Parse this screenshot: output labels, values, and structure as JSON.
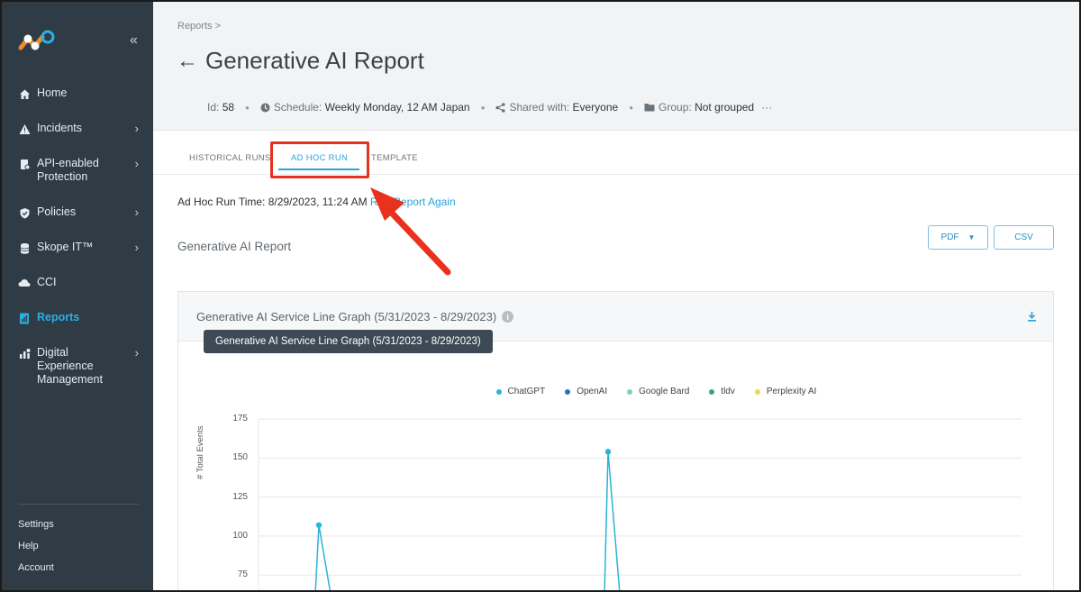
{
  "sidebar": {
    "collapse_icon": "double-chevron-left-icon",
    "items": [
      {
        "label": "Home",
        "icon": "home-icon",
        "chevron": false
      },
      {
        "label": "Incidents",
        "icon": "warning-icon",
        "chevron": true
      },
      {
        "label": "API-enabled Protection",
        "icon": "api-icon",
        "chevron": true
      },
      {
        "label": "Policies",
        "icon": "shield-icon",
        "chevron": true
      },
      {
        "label": "Skope IT™",
        "icon": "database-icon",
        "chevron": true
      },
      {
        "label": "CCI",
        "icon": "cloud-icon",
        "chevron": false
      },
      {
        "label": "Reports",
        "icon": "report-icon",
        "chevron": false,
        "active": true
      },
      {
        "label": "Digital Experience Management",
        "icon": "dem-icon",
        "chevron": true
      }
    ],
    "bottom": {
      "settings": "Settings",
      "help": "Help",
      "account": "Account"
    }
  },
  "header": {
    "breadcrumb": "Reports >",
    "title": "Generative AI Report",
    "id_label": "Id:",
    "id_value": "58",
    "schedule_label": "Schedule:",
    "schedule_value": "Weekly Monday, 12 AM Japan",
    "shared_label": "Shared with:",
    "shared_value": "Everyone",
    "group_label": "Group:",
    "group_value": "Not grouped",
    "more": "···"
  },
  "tabs": [
    {
      "label": "HISTORICAL RUNS"
    },
    {
      "label": "AD HOC RUN",
      "active": true
    },
    {
      "label": "TEMPLATE"
    }
  ],
  "run": {
    "label": "Ad Hoc Run Time: 8/29/2023, 11:24 AM",
    "link": "Run Report Again"
  },
  "report_name": "Generative AI Report",
  "buttons": {
    "pdf": "PDF",
    "csv": "CSV"
  },
  "card": {
    "title": "Generative AI Service Line Graph (5/31/2023 - 8/29/2023)",
    "tooltip": "Generative AI Service Line Graph (5/31/2023 - 8/29/2023)"
  },
  "colors": {
    "accent": "#2aa3d9",
    "sidebar_bg": "#2f3c45",
    "highlight": "#e8321d",
    "ChatGPT": "#2bb3d9",
    "OpenAI": "#2a6fc4",
    "Google Bard": "#7fd1b8",
    "tldv": "#3aa47f",
    "Perplexity AI": "#e8d84a"
  },
  "chart_data": {
    "type": "line",
    "ylabel": "# Total Events",
    "ylim": [
      75,
      175
    ],
    "yticks": [
      175,
      150,
      125,
      100,
      75
    ],
    "legend_position": "top-center",
    "grid": true,
    "series": [
      {
        "name": "ChatGPT",
        "peaks": [
          107,
          154
        ]
      },
      {
        "name": "OpenAI",
        "values": []
      },
      {
        "name": "Google Bard",
        "values": []
      },
      {
        "name": "tldv",
        "values": []
      },
      {
        "name": "Perplexity AI",
        "values": []
      }
    ]
  }
}
